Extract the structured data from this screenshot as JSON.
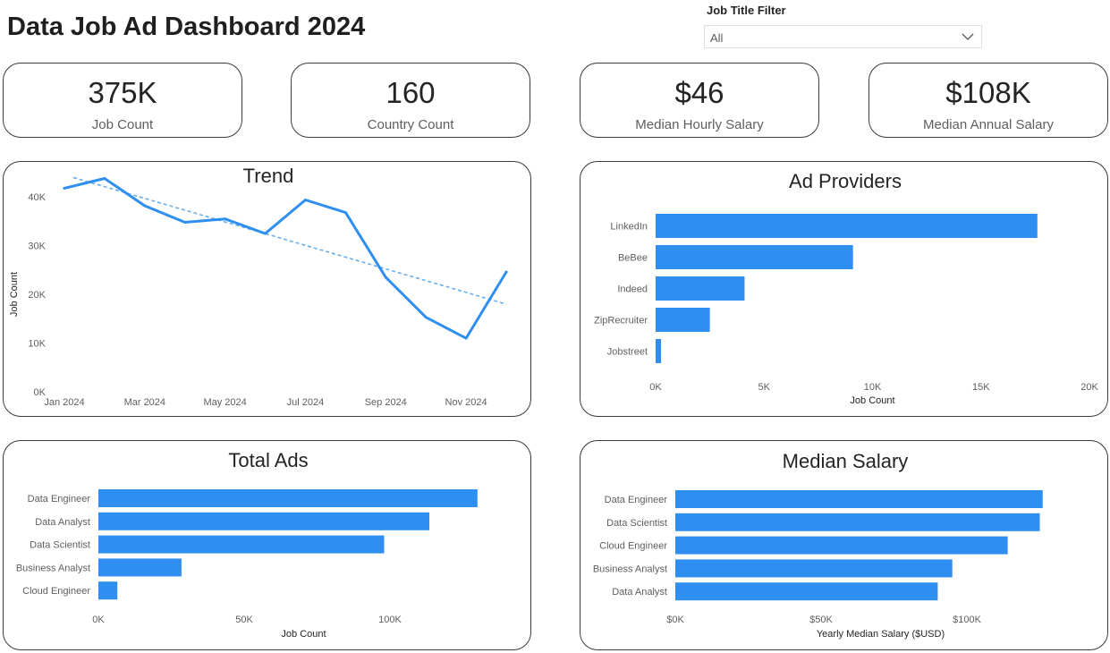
{
  "header": {
    "title": "Data Job Ad Dashboard 2024"
  },
  "filter": {
    "label": "Job Title Filter",
    "value": "All",
    "icon": "chevron-down-icon"
  },
  "kpis": [
    {
      "value": "375K",
      "label": "Job Count"
    },
    {
      "value": "160",
      "label": "Country Count"
    },
    {
      "value": "$46",
      "label": "Median Hourly Salary"
    },
    {
      "value": "$108K",
      "label": "Median Annual Salary"
    }
  ],
  "colors": {
    "bar": "#2f8ff0",
    "line": "#2f8ff0",
    "trend": "#6aaee8",
    "border": "#3a3a3a"
  },
  "chart_data": [
    {
      "id": "trend",
      "type": "line",
      "title": "Trend",
      "xlabel": "",
      "ylabel": "Job Count",
      "x": [
        "Jan 2024",
        "Feb 2024",
        "Mar 2024",
        "Apr 2024",
        "May 2024",
        "Jun 2024",
        "Jul 2024",
        "Aug 2024",
        "Sep 2024",
        "Oct 2024",
        "Nov 2024",
        "Dec 2024"
      ],
      "x_ticks": [
        "Jan 2024",
        "Mar 2024",
        "May 2024",
        "Jul 2024",
        "Sep 2024",
        "Nov 2024"
      ],
      "series": [
        {
          "values": [
            41800,
            43800,
            38200,
            34800,
            35500,
            32500,
            39400,
            36800,
            23500,
            15300,
            11000,
            24600
          ]
        }
      ],
      "trendline": {
        "start": 44000,
        "end": 18000,
        "style": "dashed"
      },
      "ylim": [
        0,
        45000
      ],
      "y_ticks": [
        "0K",
        "10K",
        "20K",
        "30K",
        "40K"
      ],
      "grid": false
    },
    {
      "id": "providers",
      "type": "bar",
      "orientation": "horizontal",
      "title": "Ad Providers",
      "categories": [
        "LinkedIn",
        "BeBee",
        "Indeed",
        "ZipRecruiter",
        "Jobstreet"
      ],
      "values": [
        17600,
        9100,
        4100,
        2500,
        250
      ],
      "xlabel": "Job Count",
      "xlim": [
        0,
        20000
      ],
      "x_ticks": [
        "0K",
        "5K",
        "10K",
        "15K",
        "20K"
      ]
    },
    {
      "id": "total-ads",
      "type": "bar",
      "orientation": "horizontal",
      "title": "Total Ads",
      "categories": [
        "Data Engineer",
        "Data Analyst",
        "Data Scientist",
        "Business Analyst",
        "Cloud Engineer"
      ],
      "values": [
        130000,
        113500,
        98000,
        28500,
        6500
      ],
      "xlabel": "Job Count",
      "xlim": [
        0,
        150000
      ],
      "x_ticks": [
        "0K",
        "50K",
        "100K"
      ]
    },
    {
      "id": "median-salary",
      "type": "bar",
      "orientation": "horizontal",
      "title": "Median Salary",
      "categories": [
        "Data Engineer",
        "Data Scientist",
        "Cloud Engineer",
        "Business Analyst",
        "Data Analyst"
      ],
      "values": [
        126000,
        125000,
        114000,
        95000,
        90000
      ],
      "xlabel": "Yearly Median Salary ($USD)",
      "xlim": [
        0,
        150000
      ],
      "x_ticks": [
        "$0K",
        "$50K",
        "$100K"
      ]
    }
  ]
}
